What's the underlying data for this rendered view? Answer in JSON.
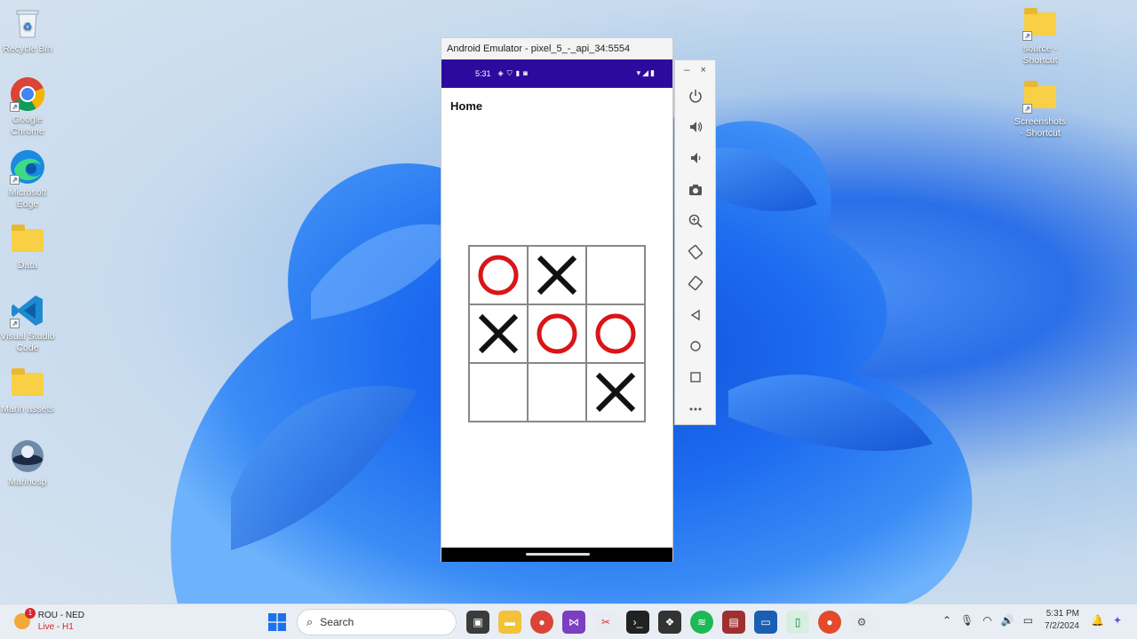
{
  "desktop": {
    "left_icons": [
      {
        "label": "Recycle Bin",
        "icon": "recycle-bin-icon"
      },
      {
        "label": "Google Chrome",
        "icon": "chrome-icon"
      },
      {
        "label": "Microsoft Edge",
        "icon": "edge-icon"
      },
      {
        "label": "Data",
        "icon": "folder-icon"
      },
      {
        "label": "Visual Studio Code",
        "icon": "vscode-icon"
      },
      {
        "label": "Marin assets",
        "icon": "folder-icon"
      },
      {
        "label": "Marinosp",
        "icon": "app-icon"
      }
    ],
    "right_icons": [
      {
        "label": "source - Shortcut",
        "icon": "folder-shortcut-icon"
      },
      {
        "label": "Screenshots - Shortcut",
        "icon": "folder-shortcut-icon"
      }
    ]
  },
  "emulator": {
    "window_title": "Android Emulator - pixel_5_-_api_34:5554",
    "status_time": "5:31",
    "app_title": "Home",
    "board": [
      "O",
      "X",
      "",
      "X",
      "O",
      "O",
      "",
      "",
      "X"
    ],
    "colors": {
      "o": "#d91518",
      "x": "#111111",
      "statusbar": "#2d0a9e"
    },
    "toolbar": {
      "minimize": "–",
      "close": "×",
      "buttons": [
        "power-icon",
        "volume-up-icon",
        "volume-down-icon",
        "camera-icon",
        "zoom-icon",
        "rotate-left-icon",
        "rotate-right-icon",
        "back-icon",
        "home-icon",
        "overview-icon",
        "more-icon"
      ]
    }
  },
  "taskbar": {
    "weather_badge": "1",
    "weather_line1": "ROU - NED",
    "weather_line2": "Live - H1",
    "search_placeholder": "Search",
    "clock_time": "5:31 PM",
    "clock_date": "7/2/2024"
  }
}
